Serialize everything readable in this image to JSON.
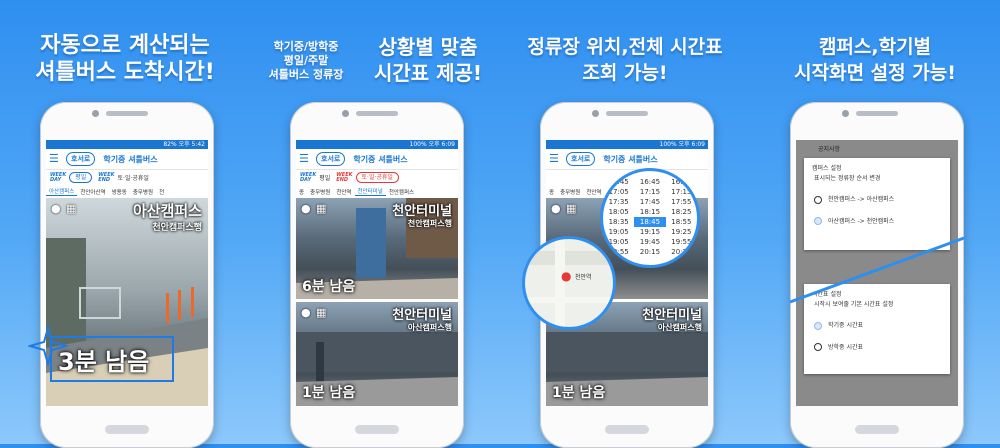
{
  "panels": [
    {
      "caption": [
        "자동으로 계산되는",
        "셔틀버스 도착시간!"
      ],
      "status": "82% 오후 5:42",
      "app_logo": "호서로",
      "app_title": "학기중 셔틀버스",
      "day_chips": [
        {
          "tag": [
            "WEEK",
            "DAY"
          ],
          "label": "평일",
          "active": true
        },
        {
          "tag": [
            "WEEK",
            "END"
          ],
          "label": "토·일·공휴일",
          "active": false
        }
      ],
      "stop_tabs": [
        "아산캠퍼스",
        "천안아산역",
        "쌍용동",
        "충무병원",
        "천"
      ],
      "active_tab": 0,
      "cards": [
        {
          "title": "아산캠퍼스",
          "dest": "천안캠퍼스행",
          "remaining": "3분 남음"
        }
      ]
    },
    {
      "caption_small": [
        "학기중/방학중",
        "평일/주말",
        "셔틀버스 정류장"
      ],
      "caption": [
        "상황별 맞춤",
        "시간표 제공!"
      ],
      "status": "100% 오후 6:09",
      "app_logo": "호서로",
      "app_title": "학기중 셔틀버스",
      "day_chips": [
        {
          "tag": [
            "WEEK",
            "DAY"
          ],
          "label": "평일",
          "active": false
        },
        {
          "tag": [
            "WEEK",
            "END"
          ],
          "label": "토·일·공휴일",
          "active": true
        }
      ],
      "stop_tabs": [
        "종",
        "충무병원",
        "천안역",
        "천안터미널",
        "천안캠퍼스"
      ],
      "active_tab": 3,
      "cards": [
        {
          "title": "천안터미널",
          "dest": "천안캠퍼스행",
          "remaining": "6분 남음"
        },
        {
          "title": "천안터미널",
          "dest": "아산캠퍼스행",
          "remaining": "1분 남음"
        }
      ]
    },
    {
      "caption": [
        "정류장 위치,전체 시간표",
        "조회 가능!"
      ],
      "status": "100% 오후 6:09",
      "app_logo": "호서로",
      "app_title": "학기중 셔틀버스",
      "stop_tabs": [
        "종",
        "충무병원",
        "천안역"
      ],
      "cards": [
        {
          "title": "천안터미널",
          "dest": "천안캠퍼스행",
          "remaining": ""
        },
        {
          "title": "천안터미널",
          "dest": "아산캠퍼스행",
          "remaining": "1분 남음"
        }
      ],
      "timetable": [
        [
          "16:45",
          "16:45",
          "16:45"
        ],
        [
          "17:05",
          "17:15",
          "17:15"
        ],
        [
          "17:35",
          "17:45",
          "17:55"
        ],
        [
          "18:05",
          "18:15",
          "18:25"
        ],
        [
          "18:35",
          "18:45",
          "18:55"
        ],
        [
          "19:05",
          "19:15",
          "19:25"
        ],
        [
          "19:05",
          "19:45",
          "19:55"
        ],
        [
          "19:55",
          "20:15",
          "20:25"
        ]
      ],
      "timetable_highlight": [
        4,
        1
      ],
      "map_label": "천안역"
    },
    {
      "caption": [
        "캠퍼스,학기별",
        "시작화면 설정 가능!"
      ],
      "notice_title": "공지사항",
      "dialog1": {
        "title": "캠퍼스 설정",
        "subtitle": "표시되는 정류장 순서 변경",
        "options": [
          "천안캠퍼스 -> 아산캠퍼스",
          "아산캠퍼스 -> 천안캠퍼스"
        ],
        "selected": 1
      },
      "dialog2": {
        "title": "시간표 설정",
        "subtitle": "시작시 보여줄 기본 시간표 설정",
        "options": [
          "학기중 시간표",
          "방학중 시간표"
        ],
        "selected": 0
      },
      "colors": {
        "accent": "#1976d2",
        "background": "#2f8ff0"
      }
    }
  ]
}
